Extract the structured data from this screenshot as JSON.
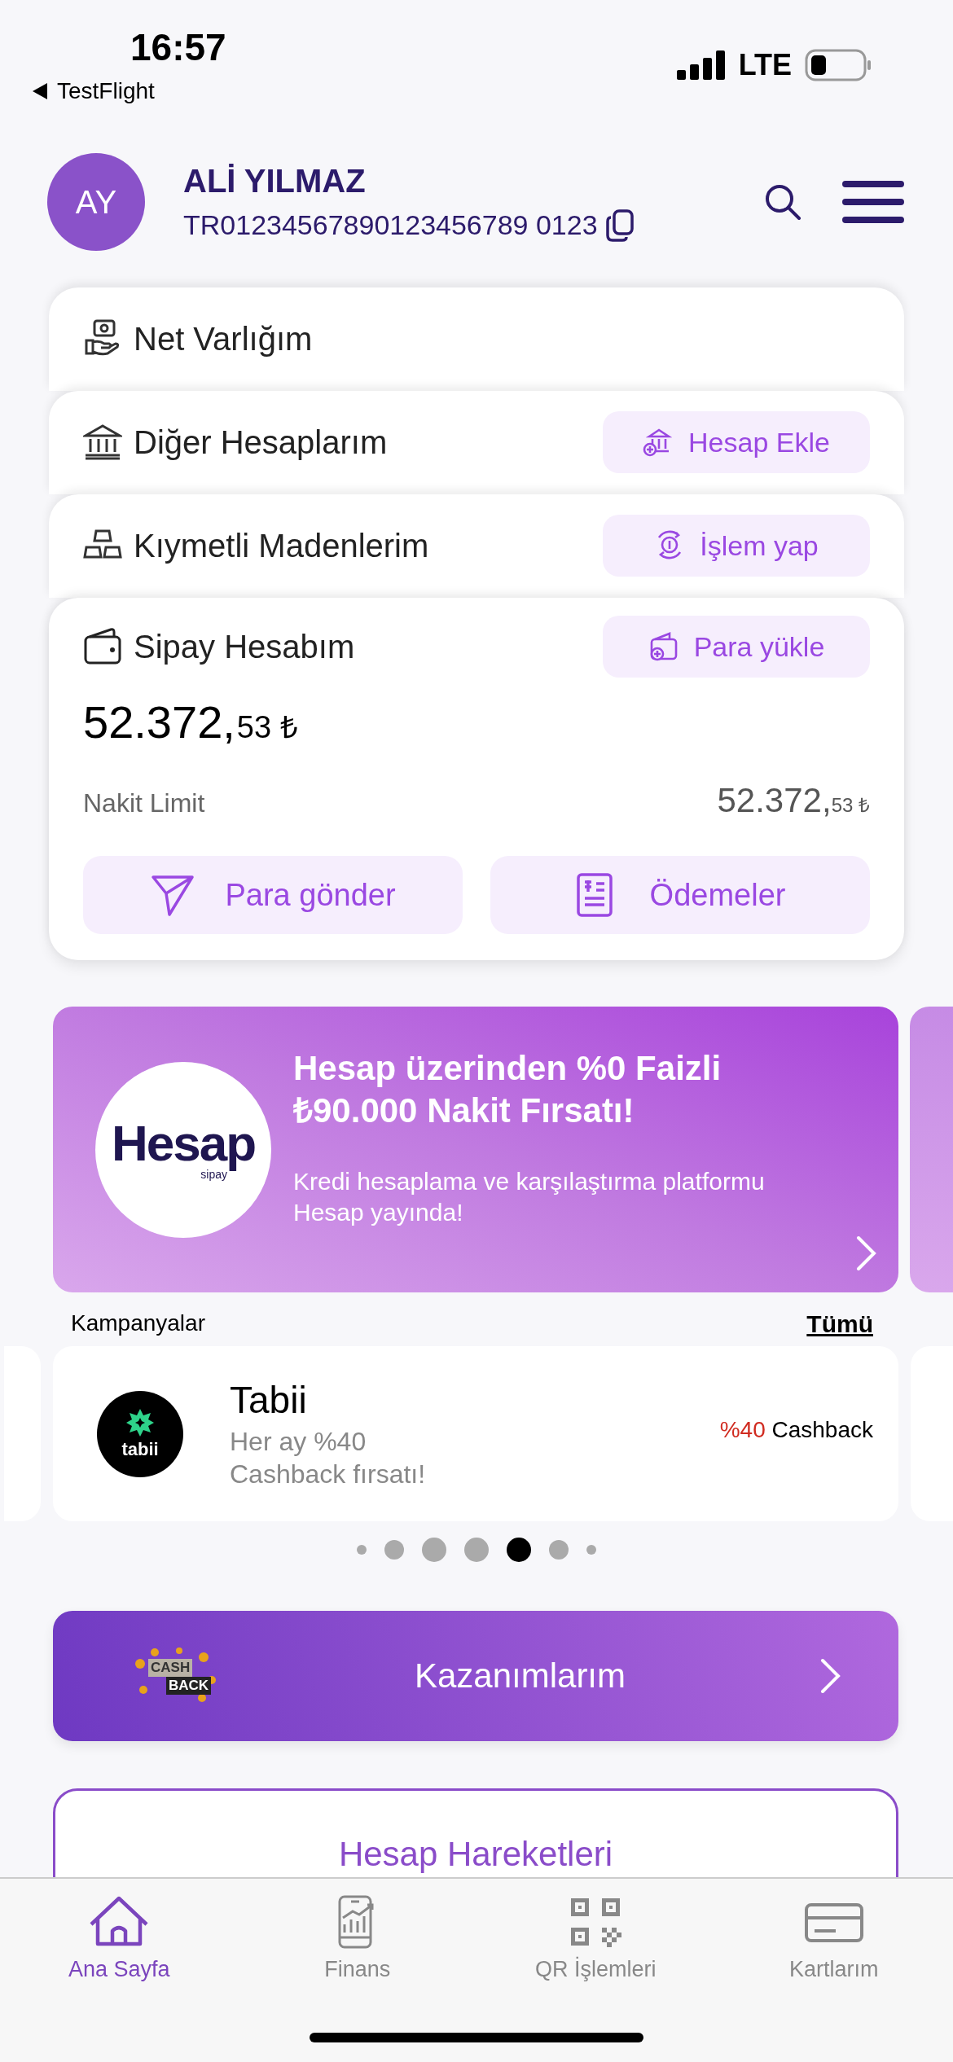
{
  "status_bar": {
    "time": "16:57",
    "back_label": "TestFlight",
    "network": "LTE"
  },
  "profile": {
    "initials": "AY",
    "name": "ALİ YILMAZ",
    "iban": "TR01234567890123456789 0123"
  },
  "account_cards": [
    {
      "kind": "net_worth",
      "title": "Net Varlığım"
    },
    {
      "kind": "accounts",
      "title": "Diğer Hesaplarım",
      "action": "Hesap Ekle"
    },
    {
      "kind": "metals",
      "title": "Kıymetli Madenlerim",
      "action": "İşlem yap"
    },
    {
      "kind": "wallet",
      "title": "Sipay Hesabım",
      "action": "Para yükle",
      "balance_main": "52.372,",
      "balance_fraction": "53",
      "currency": "₺",
      "limit_label": "Nakit Limit",
      "limit_main": "52.372,",
      "limit_fraction": "53",
      "limit_currency": "₺",
      "buttons": [
        {
          "kind": "send",
          "label": "Para gönder"
        },
        {
          "kind": "payments",
          "label": "Ödemeler"
        }
      ]
    }
  ],
  "banner": {
    "logo_text": "Hesap",
    "logo_subtext": "sipay",
    "title": "Hesap üzerinden %0 Faizli ₺90.000 Nakit Fırsatı!",
    "description": "Kredi hesaplama ve karşılaştırma platformu Hesap yayında!"
  },
  "campaigns": {
    "heading": "Kampanyalar",
    "see_all": "Tümü",
    "items": [
      {
        "logo_text": "tabii",
        "title": "Tabii",
        "description": "Her ay %40 Cashback fırsatı!",
        "discount": "%40",
        "reward": "Cashback"
      }
    ],
    "pages": [
      {
        "selected": false
      },
      {
        "selected": false
      },
      {
        "selected": false
      },
      {
        "selected": false
      },
      {
        "selected": true
      },
      {
        "selected": false
      },
      {
        "selected": false
      }
    ]
  },
  "earnings_button": {
    "label": "Kazanımlarım",
    "badge_lines": [
      "CASH",
      "BACK"
    ]
  },
  "transactions": {
    "label": "Hesap Hareketleri"
  },
  "tab_bar": [
    {
      "kind": "home",
      "label": "Ana Sayfa",
      "selected": true
    },
    {
      "kind": "finance",
      "label": "Finans",
      "selected": false
    },
    {
      "kind": "qr",
      "label": "QR İşlemleri",
      "selected": false
    },
    {
      "kind": "cards",
      "label": "Kartlarım",
      "selected": false
    }
  ]
}
